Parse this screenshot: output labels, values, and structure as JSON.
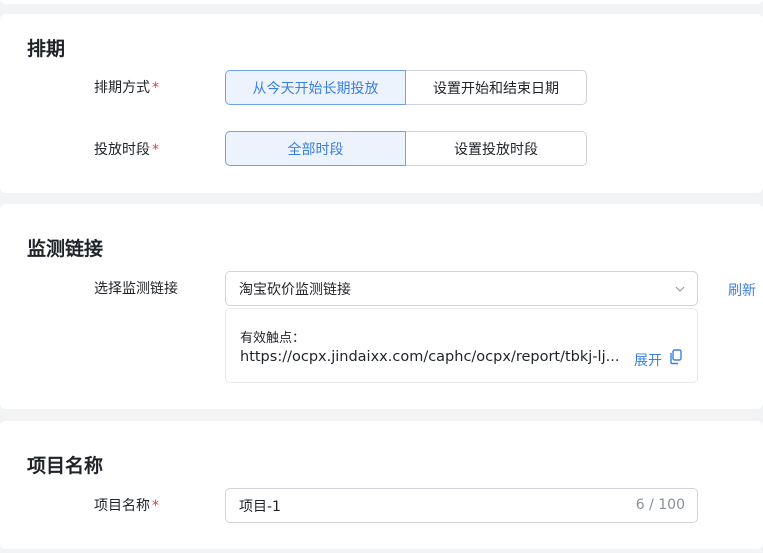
{
  "schedule": {
    "title": "排期",
    "method_label": "排期方式",
    "method_options": [
      "从今天开始长期投放",
      "设置开始和结束日期"
    ],
    "period_label": "投放时段",
    "period_options": [
      "全部时段",
      "设置投放时段"
    ],
    "required_mark": "*"
  },
  "monitor": {
    "title": "监测链接",
    "select_label": "选择监测链接",
    "select_value": "淘宝砍价监测链接",
    "refresh_label": "刷新",
    "info_title": "有效触点：",
    "info_url": "https://ocpx.jindaixx.com/caphc/ocpx/report/tbkj-lj...",
    "expand_label": "展开"
  },
  "project": {
    "title": "项目名称",
    "name_label": "项目名称",
    "name_value": "项目-1",
    "counter": "6 / 100",
    "required_mark": "*"
  },
  "colors": {
    "accent": "#3d7fe0",
    "required": "#e23b3b",
    "active_bg": "#ecf3fd"
  }
}
